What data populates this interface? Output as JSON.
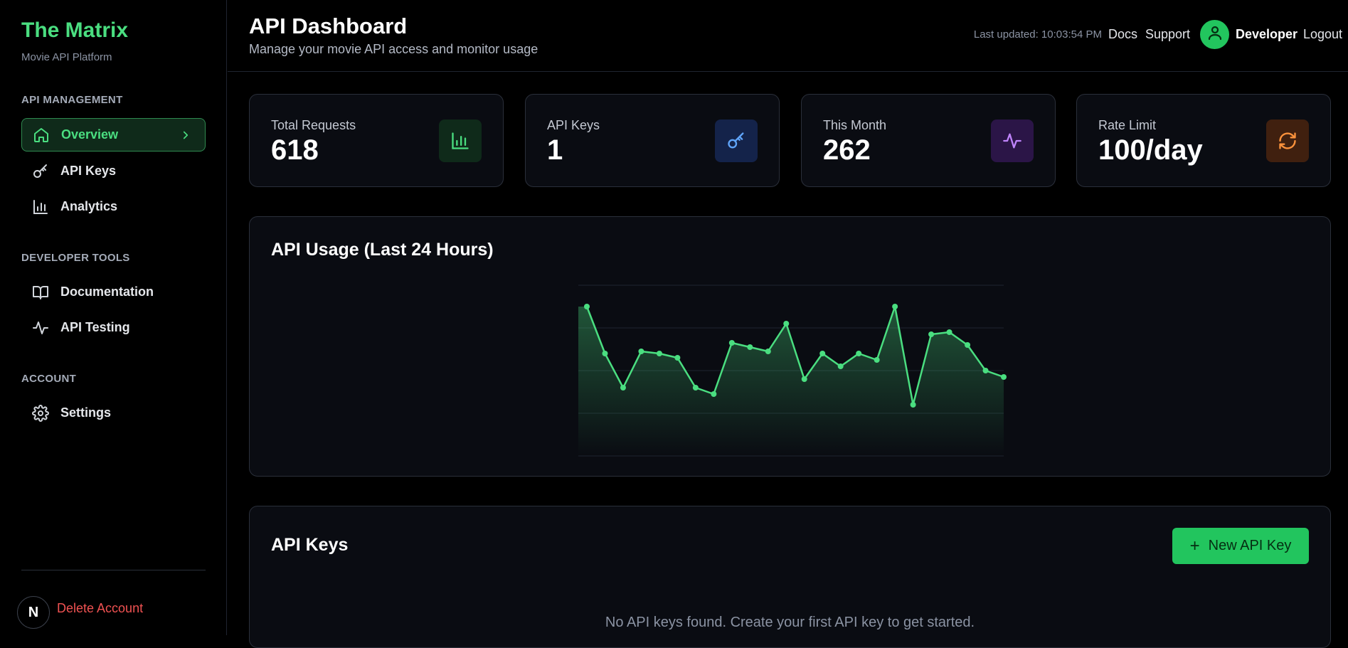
{
  "sidebar": {
    "brand": "The Matrix",
    "brand_sub": "Movie API Platform",
    "sections": [
      {
        "title": "API MANAGEMENT"
      },
      {
        "title": "DEVELOPER TOOLS"
      },
      {
        "title": "ACCOUNT"
      }
    ],
    "items": [
      {
        "label": "Overview",
        "icon": "home-icon"
      },
      {
        "label": "API Keys",
        "icon": "key-icon"
      },
      {
        "label": "Analytics",
        "icon": "bar-chart-icon"
      },
      {
        "label": "Documentation",
        "icon": "book-icon"
      },
      {
        "label": "API Testing",
        "icon": "activity-icon"
      },
      {
        "label": "Settings",
        "icon": "gear-icon"
      }
    ],
    "n_badge": "N",
    "delete_label": "Delete Account"
  },
  "header": {
    "title": "API Dashboard",
    "subtitle": "Manage your movie API access and monitor usage",
    "last_updated": "Last updated: 10:03:54 PM",
    "docs": "Docs",
    "support": "Support",
    "user": "Developer",
    "logout": "Logout"
  },
  "stats": [
    {
      "label": "Total Requests",
      "value": "618",
      "icon": "bar-chart-icon",
      "accent": "#4ade80",
      "bg": "#0f2a1a"
    },
    {
      "label": "API Keys",
      "value": "1",
      "icon": "key-icon",
      "accent": "#60a5fa",
      "bg": "#14234a"
    },
    {
      "label": "This Month",
      "value": "262",
      "icon": "activity-icon",
      "accent": "#c084fc",
      "bg": "#2b1547"
    },
    {
      "label": "Rate Limit",
      "value": "100/day",
      "icon": "refresh-icon",
      "accent": "#fb923c",
      "bg": "#40200f"
    }
  ],
  "usage": {
    "title": "API Usage (Last 24 Hours)"
  },
  "chart_data": {
    "type": "area",
    "title": "",
    "xlabel": "",
    "ylabel": "",
    "ylim": [
      0,
      40
    ],
    "grid": true,
    "values": [
      35,
      24,
      16,
      24.5,
      24,
      23,
      16,
      14.5,
      26.5,
      25.5,
      24.5,
      31,
      18,
      24,
      21,
      24,
      22.5,
      35,
      12,
      28.5,
      29,
      26,
      20,
      18.5
    ],
    "color": "#4ade80"
  },
  "keys_panel": {
    "title": "API Keys",
    "new_button": "New API Key",
    "empty": "No API keys found. Create your first API key to get started."
  }
}
